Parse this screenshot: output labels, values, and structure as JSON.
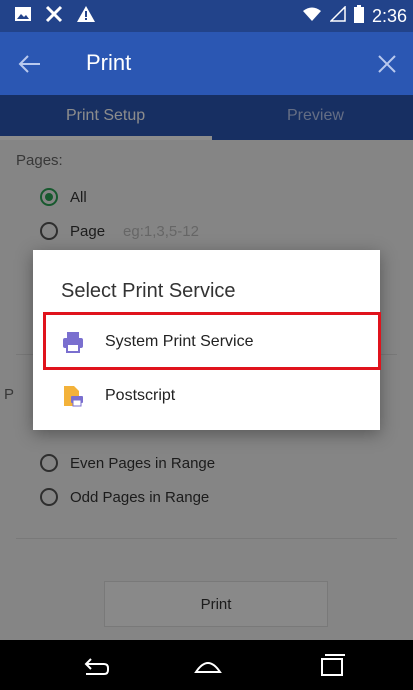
{
  "status_bar": {
    "time": "2:36",
    "left_icons": [
      "image-icon",
      "scissors-icon",
      "warning-icon"
    ],
    "right_icons": [
      "wifi-icon",
      "signal-icon",
      "battery-icon"
    ]
  },
  "app_bar": {
    "title": "Print"
  },
  "tabs": [
    {
      "label": "Print Setup",
      "selected": true
    },
    {
      "label": "Preview",
      "selected": false
    }
  ],
  "content": {
    "pages_label": "Pages:",
    "options": [
      {
        "label": "All",
        "selected": true
      },
      {
        "label": "Page",
        "hint": "eg:1,3,5-12",
        "selected": false
      }
    ],
    "hidden_label_fragment": "P",
    "range_options": [
      {
        "label": "Even Pages in Range",
        "selected": false
      },
      {
        "label": "Odd Pages in Range",
        "selected": false
      }
    ],
    "print_button": "Print"
  },
  "dialog": {
    "title": "Select Print Service",
    "items": [
      {
        "label": "System Print Service",
        "icon": "printer-icon",
        "highlighted": true
      },
      {
        "label": "Postscript",
        "icon": "postscript-file-icon",
        "highlighted": false
      }
    ]
  },
  "colors": {
    "primary": "#2b57b3",
    "statusbar": "#22438a",
    "accent_green": "#2aa255",
    "highlight_red": "#e0131c"
  }
}
